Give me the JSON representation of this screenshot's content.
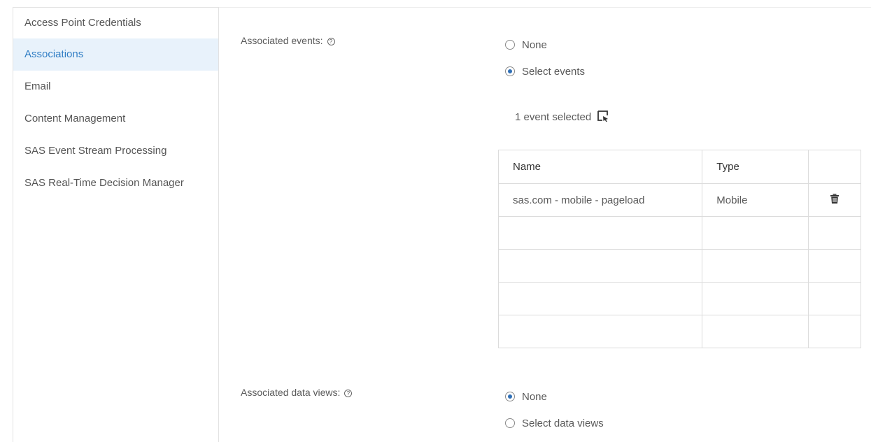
{
  "sidebar": {
    "items": [
      {
        "label": "Access Point Credentials",
        "active": false
      },
      {
        "label": "Associations",
        "active": true
      },
      {
        "label": "Email",
        "active": false
      },
      {
        "label": "Content Management",
        "active": false
      },
      {
        "label": "SAS Event Stream Processing",
        "active": false
      },
      {
        "label": "SAS Real-Time Decision Manager",
        "active": false
      }
    ]
  },
  "events": {
    "label": "Associated events:",
    "help_icon": "help-circle-icon",
    "options": [
      {
        "label": "None",
        "checked": false
      },
      {
        "label": "Select events",
        "checked": true
      }
    ],
    "selected_text": "1 event selected",
    "select_icon": "select-cursor-icon",
    "table": {
      "headers": [
        "Name",
        "Type",
        ""
      ],
      "rows": [
        {
          "name": "sas.com - mobile - pageload",
          "type": "Mobile",
          "action_icon": "trash-icon"
        },
        {
          "name": "",
          "type": ""
        },
        {
          "name": "",
          "type": ""
        },
        {
          "name": "",
          "type": ""
        },
        {
          "name": "",
          "type": ""
        }
      ]
    }
  },
  "data_views": {
    "label": "Associated data views:",
    "help_icon": "help-circle-icon",
    "options": [
      {
        "label": "None",
        "checked": true
      },
      {
        "label": "Select data views",
        "checked": false
      }
    ]
  },
  "colors": {
    "accent": "#2f7dc4",
    "active_bg": "#e8f2fb",
    "radio_dot": "#2f6fb6"
  }
}
